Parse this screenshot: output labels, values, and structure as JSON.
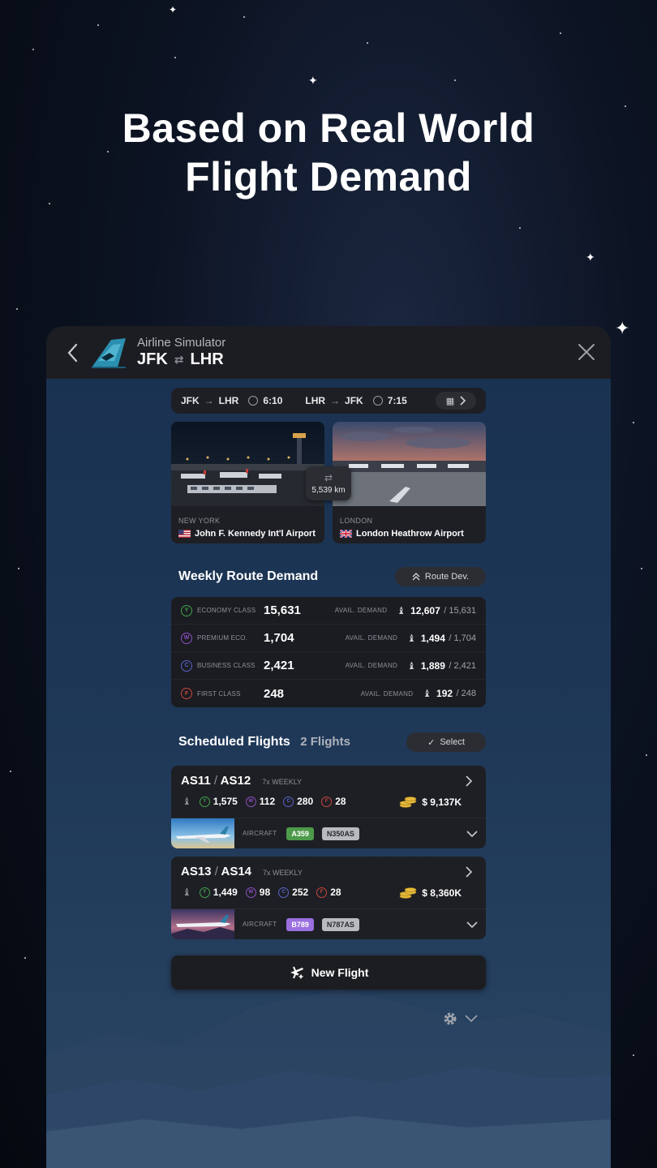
{
  "headline": {
    "line1": "Based on Real World",
    "line2": "Flight Demand"
  },
  "header": {
    "app_name": "Airline Simulator",
    "origin": "JFK",
    "destination": "LHR"
  },
  "legs": [
    {
      "from": "JFK",
      "to": "LHR",
      "duration": "6:10"
    },
    {
      "from": "LHR",
      "to": "JFK",
      "duration": "7:15"
    }
  ],
  "airports": {
    "origin": {
      "city": "NEW YORK",
      "name": "John F. Kennedy Int'l Airport"
    },
    "destination": {
      "city": "LONDON",
      "name": "London Heathrow Airport"
    },
    "distance": "5,539 km"
  },
  "demand": {
    "title": "Weekly Route Demand",
    "route_dev_label": "Route Dev.",
    "avail_label": "AVAIL. DEMAND",
    "rows": [
      {
        "badge": "Y",
        "name": "ECONOMY CLASS",
        "value": "15,631",
        "avail": "12,607",
        "total": "/ 15,631",
        "color": "#3fa34d"
      },
      {
        "badge": "W",
        "name": "PREMIUM ECO.",
        "value": "1,704",
        "avail": "1,494",
        "total": "/ 1,704",
        "color": "#8e4fc4"
      },
      {
        "badge": "C",
        "name": "BUSINESS CLASS",
        "value": "2,421",
        "avail": "1,889",
        "total": "/ 2,421",
        "color": "#5865c9"
      },
      {
        "badge": "F",
        "name": "FIRST CLASS",
        "value": "248",
        "avail": "192",
        "total": "/ 248",
        "color": "#c9473f"
      }
    ]
  },
  "scheduled": {
    "title": "Scheduled Flights",
    "count": "2 Flights",
    "select_label": "Select",
    "flights": [
      {
        "code_out": "AS11",
        "code_back": "AS12",
        "weekly": "7x WEEKLY",
        "y": "1,575",
        "w": "112",
        "c": "280",
        "f": "28",
        "revenue": "$ 9,137K",
        "aircraft_label": "AIRCRAFT",
        "type": "A359",
        "reg": "N350AS",
        "type_color": "#4d9a4a"
      },
      {
        "code_out": "AS13",
        "code_back": "AS14",
        "weekly": "7x WEEKLY",
        "y": "1,449",
        "w": "98",
        "c": "252",
        "f": "28",
        "revenue": "$ 8,360K",
        "aircraft_label": "AIRCRAFT",
        "type": "B789",
        "reg": "N787AS",
        "type_color": "#9a6fe0"
      }
    ]
  },
  "new_flight_label": "New Flight",
  "icons": {
    "back": "chevron-left-icon",
    "close": "close-icon",
    "swap": "swap-icon",
    "clock": "clock-icon",
    "seat": "seat-icon",
    "coins": "coins-icon",
    "plane": "plane-add-icon",
    "gear": "gear-icon"
  }
}
